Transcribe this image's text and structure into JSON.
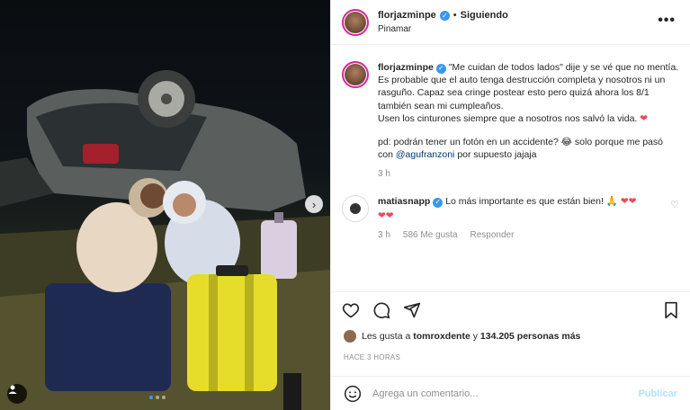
{
  "post": {
    "username": "florjazminpe",
    "follow_state": "Siguiendo",
    "location": "Pinamar",
    "more_label": "•••"
  },
  "caption": {
    "username": "florjazminpe",
    "text": "\"Me cuidan de todos lados\" dije y se vé que no mentía.\nEs probable que el auto tenga destrucción completa y nosotros ni un rasguño. Capaz sea cringe postear esto pero quizá ahora los 8/1 también sean mi cumpleaños.\nUsen los cinturones siempre que a nosotros nos salvó la vida.",
    "heart": "❤",
    "ps_before": "pd: podrán tener un fotón en un accidente? 😂 solo porque me pasó con ",
    "ps_mention": "@agufranzoni",
    "ps_after": " por supuesto jajaja",
    "time": "3 h"
  },
  "comment": {
    "username": "matiasnapp",
    "text": "Lo más importante es que están bien! 🙏",
    "hearts_line1": "❤❤",
    "hearts_line2": "❤❤",
    "time": "3 h",
    "likes": "586 Me gusta",
    "reply": "Responder"
  },
  "likes": {
    "prefix": "Les gusta a ",
    "user": "tomroxdente",
    "middle": " y ",
    "count": "134.205 personas más"
  },
  "timestamp": "HACE 3 HORAS",
  "composer": {
    "placeholder": "Agrega un comentario...",
    "publish": "Publicar"
  },
  "photo": {
    "next_label": "›"
  },
  "colors": {
    "accent": "#3897f0",
    "heart": "#ed4956",
    "muted": "#8e8e8e"
  }
}
